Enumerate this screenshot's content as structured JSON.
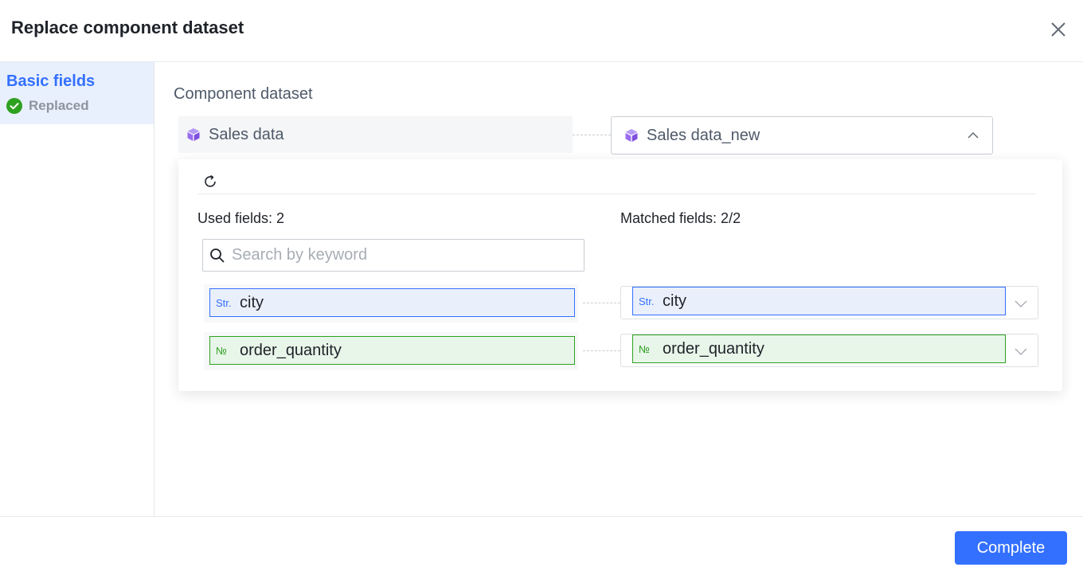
{
  "dialog": {
    "title": "Replace component dataset"
  },
  "sidebar": {
    "items": [
      {
        "label": "Basic fields",
        "status": "Replaced"
      }
    ]
  },
  "main": {
    "section_label": "Component dataset",
    "source_dataset": "Sales data",
    "target_dataset": "Sales data_new",
    "panel": {
      "used_fields_label": "Used fields: 2",
      "matched_fields_label": "Matched fields: 2/2",
      "search_placeholder": "Search by keyword",
      "rows": [
        {
          "type_tag": "Str.",
          "source_field": "city",
          "target_field": "city"
        },
        {
          "type_tag": "№",
          "source_field": "order_quantity",
          "target_field": "order_quantity"
        }
      ]
    }
  },
  "footer": {
    "complete_label": "Complete"
  },
  "colors": {
    "accent": "#3370ff",
    "string_field_bg": "#e9effb",
    "number_field_border": "#2ea121",
    "number_field_bg": "#e8f5e9",
    "dataset_icon": "#9a6cf0",
    "success": "#2ea121"
  },
  "icons": {
    "close": "close-icon",
    "check": "check-circle-icon",
    "dataset": "cube-icon",
    "caret_up": "chevron-up-icon",
    "refresh": "refresh-icon",
    "search": "search-icon",
    "dropdown": "chevron-down-icon"
  }
}
